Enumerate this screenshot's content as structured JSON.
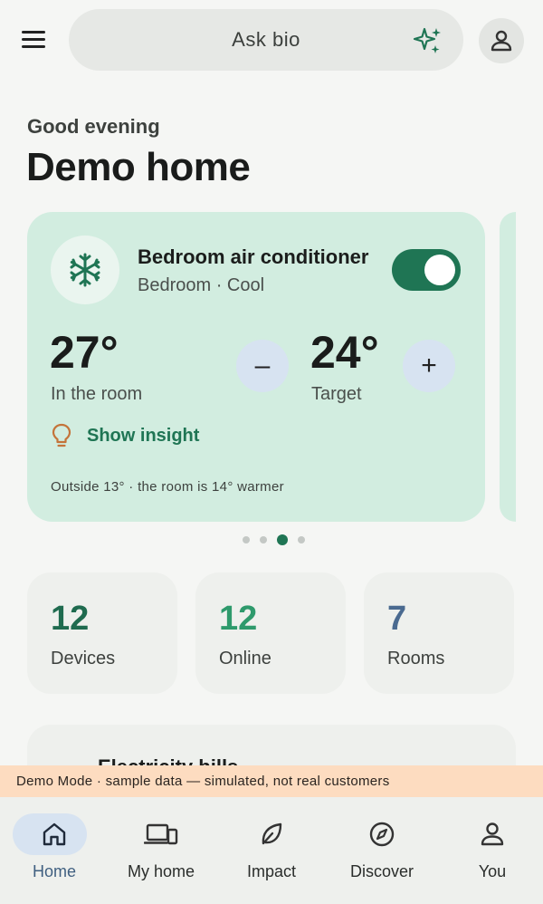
{
  "header": {
    "search_placeholder": "Ask bio"
  },
  "greeting": "Good evening",
  "home_name": "Demo home",
  "device_card": {
    "name": "Bedroom air conditioner",
    "subtitle": "Bedroom · Cool",
    "power_on": true,
    "current_temp": "27°",
    "current_label": "In the room",
    "target_temp": "24°",
    "target_label": "Target",
    "decrease_label": "–",
    "increase_label": "+",
    "insight_label": "Show insight",
    "outside_note": "Outside 13° · the room is 14° warmer",
    "carousel_active_index": 2,
    "carousel_count": 4
  },
  "stats": [
    {
      "value": "12",
      "label": "Devices",
      "color": "#1f6b4f"
    },
    {
      "value": "12",
      "label": "Online",
      "color": "#2e9a6c"
    },
    {
      "value": "7",
      "label": "Rooms",
      "color": "#4a6a90"
    }
  ],
  "bills": {
    "title": "Electricity bills"
  },
  "demo_banner": "Demo Mode · sample data — simulated, not real customers",
  "bottom_nav": [
    {
      "label": "Home",
      "icon": "home-icon",
      "active": true
    },
    {
      "label": "My home",
      "icon": "devices-icon",
      "active": false
    },
    {
      "label": "Impact",
      "icon": "leaf-icon",
      "active": false
    },
    {
      "label": "Discover",
      "icon": "compass-icon",
      "active": false
    },
    {
      "label": "You",
      "icon": "person-icon",
      "active": false
    }
  ],
  "colors": {
    "accent": "#1f7554",
    "card_bg": "#d2ede0",
    "nav_active": "#d7e3f1",
    "banner_bg": "#fddcc0"
  }
}
